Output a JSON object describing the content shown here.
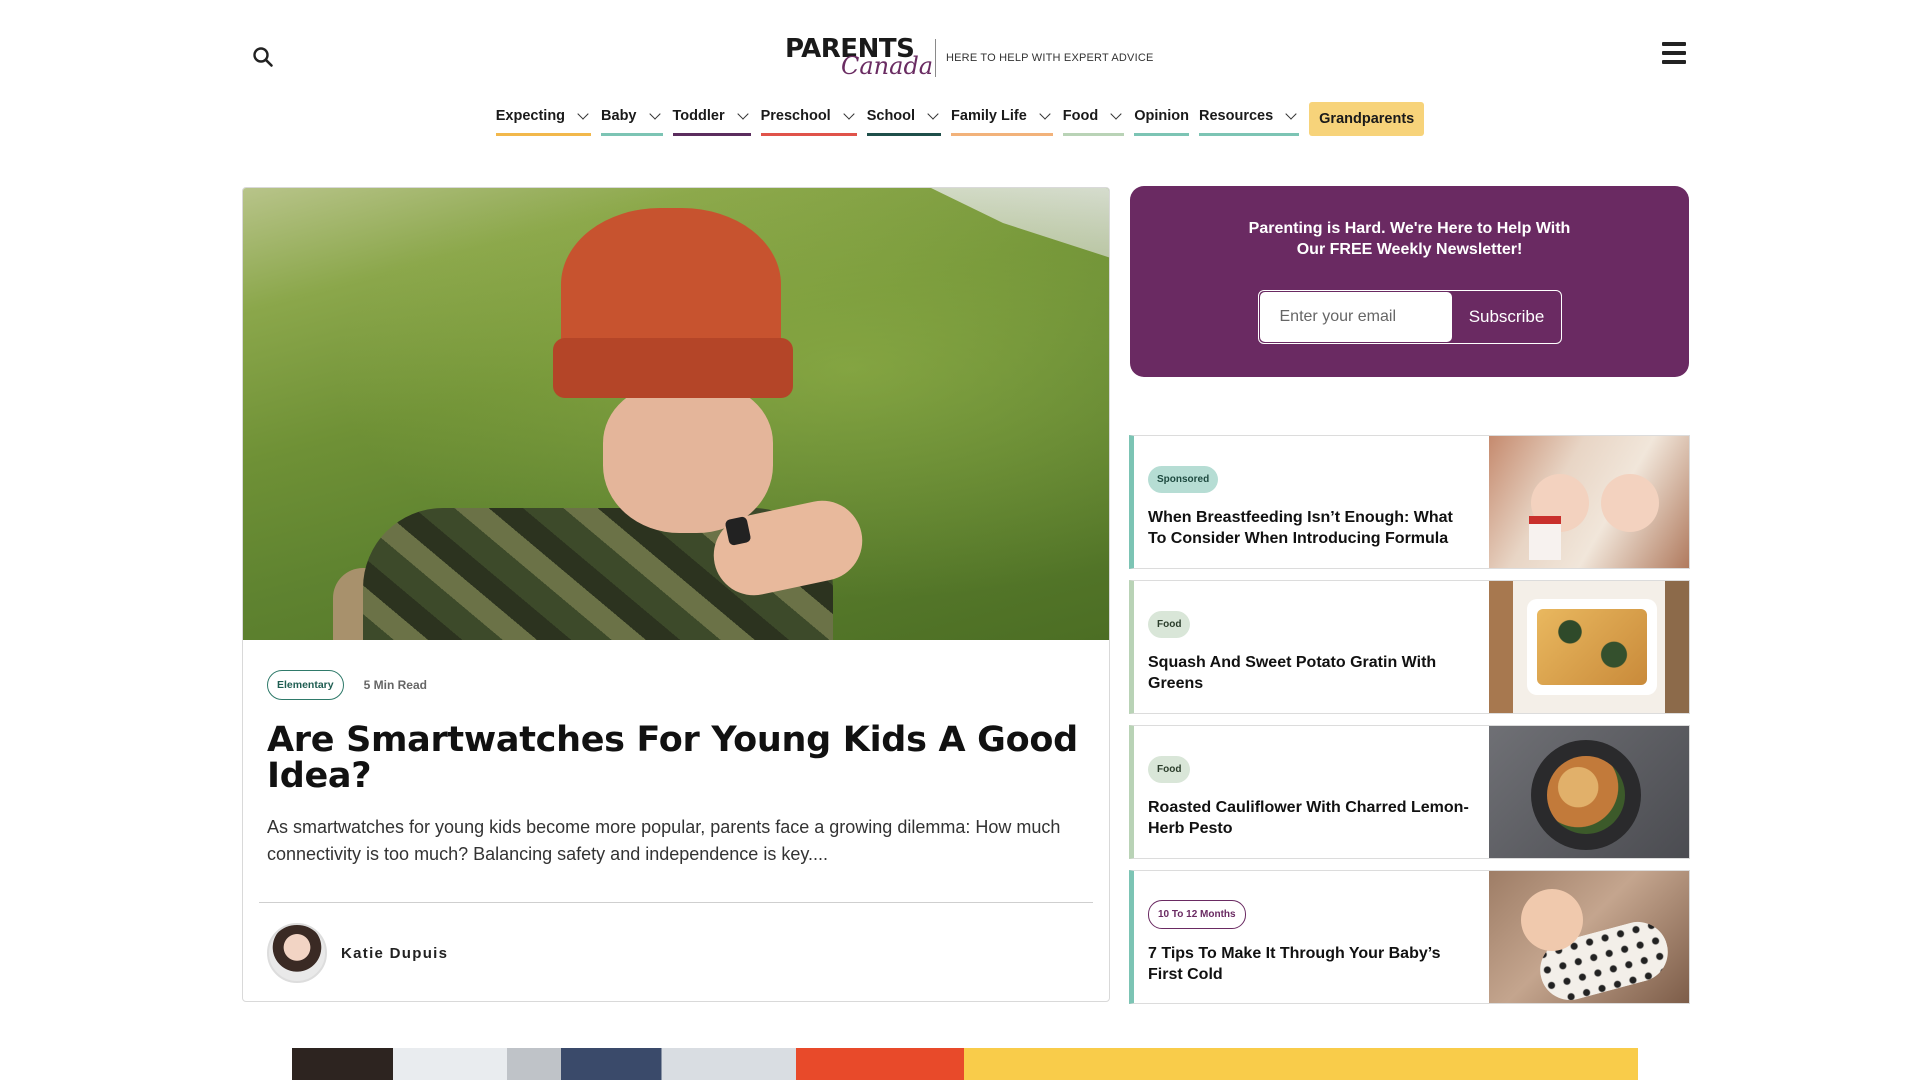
{
  "header": {
    "logo_primary": "PARENTS",
    "logo_secondary": "Canada",
    "tagline": "HERE TO HELP WITH EXPERT ADVICE",
    "search_icon": "search-icon",
    "menu_icon": "hamburger-menu-icon"
  },
  "nav": {
    "items": [
      {
        "label": "Expecting",
        "has_dropdown": true,
        "underline_color": "#f2b84b"
      },
      {
        "label": "Baby",
        "has_dropdown": true,
        "underline_color": "#7cc4b4"
      },
      {
        "label": "Toddler",
        "has_dropdown": true,
        "underline_color": "#5b2d5e"
      },
      {
        "label": "Preschool",
        "has_dropdown": true,
        "underline_color": "#e0534a"
      },
      {
        "label": "School",
        "has_dropdown": true,
        "underline_color": "#1f4f4a"
      },
      {
        "label": "Family Life",
        "has_dropdown": true,
        "underline_color": "#f2b27a"
      },
      {
        "label": "Food",
        "has_dropdown": true,
        "underline_color": "#b9d3b6"
      },
      {
        "label": "Opinion",
        "has_dropdown": false,
        "underline_color": "#7cc4b4"
      },
      {
        "label": "Resources",
        "has_dropdown": true,
        "underline_color": "#7cc4b4"
      },
      {
        "label": "Grandparents",
        "has_dropdown": false,
        "highlight_color": "#f7d37a"
      }
    ]
  },
  "feature": {
    "tag": "Elementary",
    "read_time": "5 Min Read",
    "title": "Are Smartwatches For Young Kids A Good Idea?",
    "excerpt": "As smartwatches for young kids become more popular, parents face a growing dilemma: How much connectivity is too much? Balancing safety and independence is key....",
    "author": "Katie Dupuis"
  },
  "newsletter": {
    "title": "Parenting is Hard. We're Here to Help With Our FREE Weekly Newsletter!",
    "email_placeholder": "Enter your email",
    "subscribe_label": "Subscribe",
    "background_color": "#6a2a62"
  },
  "side_articles": [
    {
      "tag": "Sponsored",
      "title": "When Breastfeeding Isn’t Enough: What To Consider When Introducing Formula",
      "accent": "#7cc4b4"
    },
    {
      "tag": "Food",
      "title": "Squash And Sweet Potato Gratin With Greens",
      "accent": "#b9d3b6"
    },
    {
      "tag": "Food",
      "title": "Roasted Cauliflower With Charred Lemon-Herb Pesto",
      "accent": "#b9d3b6"
    },
    {
      "tag": "10 To 12 Months",
      "title": "7 Tips To Make It Through Your Baby’s First Cold",
      "accent": "#7cc4b4"
    }
  ]
}
